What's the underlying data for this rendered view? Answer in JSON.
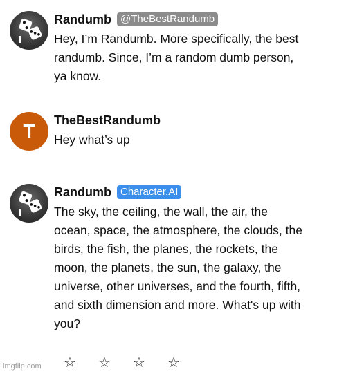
{
  "messages": [
    {
      "sender": "Randumb",
      "tag": "@TheBestRandumb",
      "text": "Hey, I’m Randumb. More specifically, the best randumb. Since, I’m a random dumb person, ya know."
    },
    {
      "sender": "TheBestRandumb",
      "avatar_letter": "T",
      "text": "Hey what’s up"
    },
    {
      "sender": "Randumb",
      "tag": "Character.AI",
      "text": "The sky, the ceiling, the wall, the air, the ocean, space, the atmosphere, the clouds, the birds, the fish, the planes, the rockets, the moon, the planets, the sun, the galaxy, the universe, other universes, and the fourth, fifth, and sixth dimension and more. What's up with you?"
    }
  ],
  "rating": {
    "stars": [
      "☆",
      "☆",
      "☆",
      "☆"
    ]
  },
  "watermark": "imgflip.com",
  "colors": {
    "user_avatar": "#c85a0a",
    "handle_tag": "#8c8c8c",
    "ai_tag": "#3b8eea"
  }
}
